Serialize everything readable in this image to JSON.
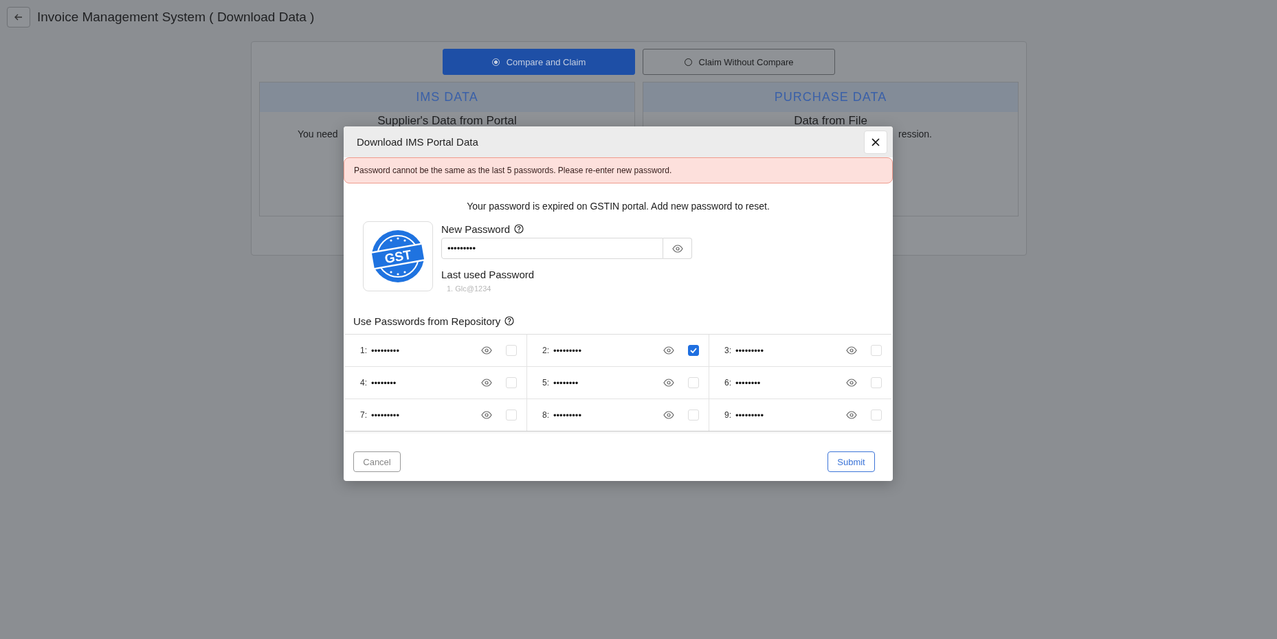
{
  "header": {
    "title": "Invoice Management System ( Download Data )"
  },
  "mode_options": [
    {
      "label": "Compare and Claim",
      "selected": true
    },
    {
      "label": "Claim Without Compare",
      "selected": false
    }
  ],
  "panels": [
    {
      "title": "IMS DATA",
      "subtitle": "Supplier's Data from Portal",
      "text": "You need"
    },
    {
      "title": "PURCHASE DATA",
      "subtitle": "Data from File",
      "text": "ression."
    }
  ],
  "dialog": {
    "title": "Download IMS Portal Data",
    "error": "Password cannot be the same as the last 5 passwords. Please re-enter new password.",
    "message": "Your password is expired on GSTIN portal. Add new password to reset.",
    "logo_text": "GST",
    "new_password": {
      "label": "New Password",
      "value": "•••••••••"
    },
    "last_used": {
      "label": "Last used Password",
      "items": [
        "1. Glc@1234"
      ]
    },
    "repository": {
      "label": "Use Passwords from Repository",
      "entries": [
        {
          "index": "1:",
          "value": "•••••••••",
          "checked": false
        },
        {
          "index": "2:",
          "value": "•••••••••",
          "checked": true
        },
        {
          "index": "3:",
          "value": "•••••••••",
          "checked": false
        },
        {
          "index": "4:",
          "value": "••••••••",
          "checked": false
        },
        {
          "index": "5:",
          "value": "••••••••",
          "checked": false
        },
        {
          "index": "6:",
          "value": "••••••••",
          "checked": false
        },
        {
          "index": "7:",
          "value": "•••••••••",
          "checked": false
        },
        {
          "index": "8:",
          "value": "•••••••••",
          "checked": false
        },
        {
          "index": "9:",
          "value": "•••••••••",
          "checked": false
        }
      ]
    },
    "buttons": [
      "Cancel",
      "Submit"
    ]
  }
}
